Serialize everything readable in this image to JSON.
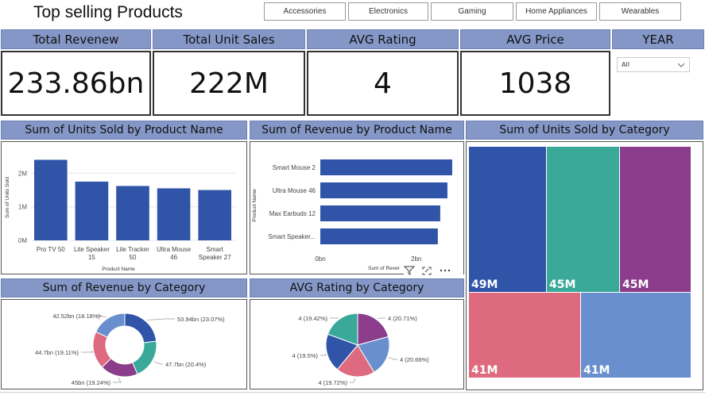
{
  "page_title": "Top selling Products",
  "slicers": [
    "Accessories",
    "Electronics",
    "Gaming",
    "Home Appliances",
    "Wearables"
  ],
  "kpis": [
    {
      "label": "Total Revenew",
      "value": "233.86bn"
    },
    {
      "label": "Total Unit Sales",
      "value": "222M"
    },
    {
      "label": "AVG Rating",
      "value": "4"
    },
    {
      "label": "AVG Price",
      "value": "1038"
    }
  ],
  "year": {
    "label": "YEAR",
    "selected": "All"
  },
  "units_by_product": {
    "title": "Sum of Units Sold by Product Name",
    "chart_data": {
      "type": "bar",
      "categories": [
        "Pro TV 50",
        "Lite Speaker 15",
        "Lite Tracker 50",
        "Ultra Mouse 46",
        "Smart Speaker 27"
      ],
      "category_lines": [
        [
          "Pro TV 50"
        ],
        [
          "Lite Speaker",
          "15"
        ],
        [
          "Lite Tracker",
          "50"
        ],
        [
          "Ultra Mouse",
          "46"
        ],
        [
          "Smart",
          "Speaker 27"
        ]
      ],
      "values": [
        2.4,
        1.75,
        1.62,
        1.55,
        1.5
      ],
      "value_unit": "M",
      "ylim": [
        0,
        2.6
      ],
      "yticks": [
        "0M",
        "1M",
        "2M"
      ],
      "xlabel": "Product Name",
      "ylabel": "Sum of Units Sold"
    }
  },
  "revenue_by_product": {
    "title": "Sum of Revenue by Product Name",
    "chart_data": {
      "type": "bar",
      "orientation": "horizontal",
      "categories": [
        "Smart Mouse 2",
        "Ultra Mouse 46",
        "Max Earbuds 12",
        "Smart Speaker..."
      ],
      "values": [
        2.75,
        2.65,
        2.5,
        2.45
      ],
      "value_unit": "bn",
      "xlim": [
        0,
        2.85
      ],
      "xticks": [
        "0bn",
        "2bn"
      ],
      "xlabel": "Sum of Rever",
      "ylabel": "Product Name"
    }
  },
  "units_by_category": {
    "title": "Sum of Units Sold by Category",
    "chart_data": {
      "type": "treemap",
      "labels": [
        "49M",
        "45M",
        "45M",
        "41M",
        "41M"
      ],
      "colors": [
        "#2f54a8",
        "#3aa99a",
        "#8b3c8a",
        "#dd6a7e",
        "#6a8fcf"
      ]
    }
  },
  "revenue_by_category": {
    "title": "Sum of Revenue by Category",
    "chart_data": {
      "type": "pie",
      "donut": true,
      "labels": [
        "53.94bn (23.07%)",
        "47.7bn (20.4%)",
        "45bn (19.24%)",
        "44.7bn (19.11%)",
        "42.52bn (18.18%)"
      ],
      "values": [
        53.94,
        47.7,
        45,
        44.7,
        42.52
      ],
      "colors": [
        "#2f54a8",
        "#3aa99a",
        "#8b3c8a",
        "#dd6a7e",
        "#6a8fcf"
      ]
    }
  },
  "rating_by_category": {
    "title": "AVG Rating by Category",
    "chart_data": {
      "type": "pie",
      "labels": [
        "4 (20.71%)",
        "4 (20.66%)",
        "4 (19.72%)",
        "4 (19.5%)",
        "4 (19.42%)"
      ],
      "values": [
        20.71,
        20.66,
        19.72,
        19.5,
        19.42
      ],
      "colors": [
        "#8b3c8a",
        "#6a8fcf",
        "#dd6a7e",
        "#2f54a8",
        "#3aa99a"
      ]
    }
  },
  "icons": [
    "filter-icon",
    "focus-mode-icon",
    "more-options-icon",
    "chevron-down-icon"
  ]
}
